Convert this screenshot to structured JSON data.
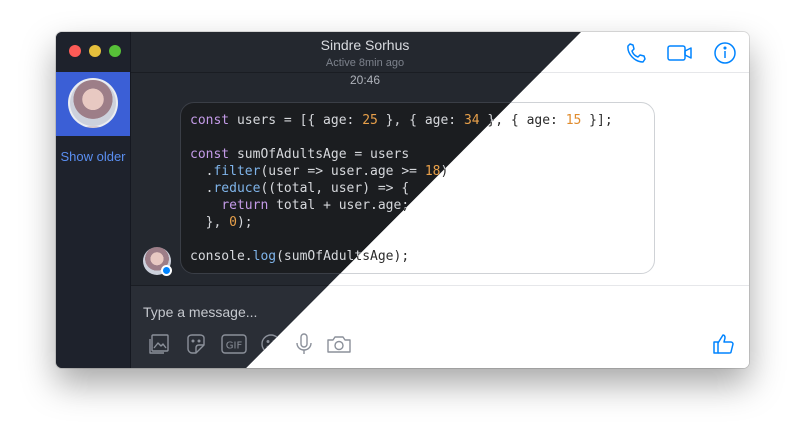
{
  "window": {
    "contact_name": "Sindre Sorhus",
    "contact_status": "Active 8min ago"
  },
  "sidebar": {
    "show_older": "Show older"
  },
  "conversation": {
    "timestamp": "20:46"
  },
  "composer": {
    "placeholder": "Type a message..."
  },
  "icons": {
    "header": [
      "phone-icon",
      "video-camera-icon",
      "info-icon"
    ],
    "toolbar": [
      "image-icon",
      "sticker-icon",
      "gif-icon",
      "emoji-icon",
      "microphone-icon",
      "camera-icon",
      "thumbs-up-icon"
    ]
  },
  "colors": {
    "accent": "#0084ff",
    "dark_bg": "#24282f"
  }
}
